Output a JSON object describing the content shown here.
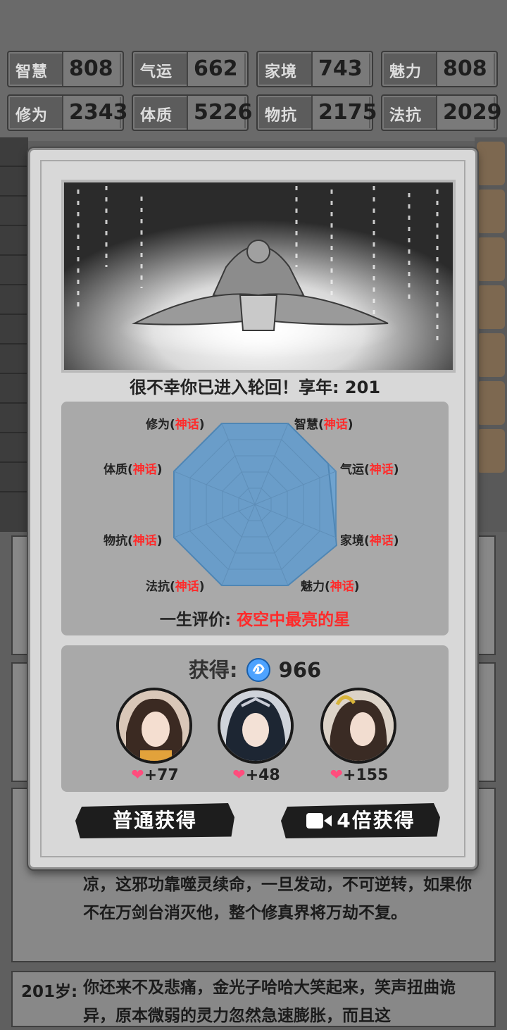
{
  "stats": [
    {
      "label": "智慧",
      "value": "808"
    },
    {
      "label": "气运",
      "value": "662"
    },
    {
      "label": "家境",
      "value": "743"
    },
    {
      "label": "魅力",
      "value": "808"
    },
    {
      "label": "修为",
      "value": "2343"
    },
    {
      "label": "体质",
      "value": "5226"
    },
    {
      "label": "物抗",
      "value": "2175"
    },
    {
      "label": "法抗",
      "value": "2029"
    }
  ],
  "modal": {
    "death_title": "很不幸你已进入轮回！享年: 201",
    "attributes": [
      {
        "name": "修为",
        "level": "神话",
        "wrap_l": "(",
        "wrap_r": ")"
      },
      {
        "name": "智慧",
        "level": "神话",
        "wrap_l": "(",
        "wrap_r": ")"
      },
      {
        "name": "体质",
        "level": "神话",
        "wrap_l": "(",
        "wrap_r": ")"
      },
      {
        "name": "气运",
        "level": "神话",
        "wrap_l": "(",
        "wrap_r": ")"
      },
      {
        "name": "物抗",
        "level": "神话",
        "wrap_l": "(",
        "wrap_r": ")"
      },
      {
        "name": "家境",
        "level": "神话",
        "wrap_l": "(",
        "wrap_r": ")"
      },
      {
        "name": "法抗",
        "level": "神话",
        "wrap_l": "(",
        "wrap_r": ")"
      },
      {
        "name": "魅力",
        "level": "神话",
        "wrap_l": "(",
        "wrap_r": ")"
      }
    ],
    "evaluation_label": "一生评价: ",
    "evaluation_value": "夜空中最亮的星",
    "reward_label": "获得:",
    "reward_amount": "966",
    "affinities": [
      "+77",
      "+48",
      "+155"
    ],
    "btn_normal": "普通获得",
    "btn_video": "4倍获得"
  },
  "story": {
    "text1": "凉，这邪功靠噬灵续命，一旦发动，不可逆转，如果你不在万剑台消灭他，整个修真界将万劫不复。",
    "age2": "201岁:",
    "text2": "你还来不及悲痛，金光子哈哈大笑起来，笑声扭曲诡异，原本微弱的灵力忽然急速膨胀，而且这"
  },
  "colors": {
    "accent_red": "#ff2b2b",
    "radar_fill": "#6fa3cf",
    "heart": "#ff4d7d"
  }
}
